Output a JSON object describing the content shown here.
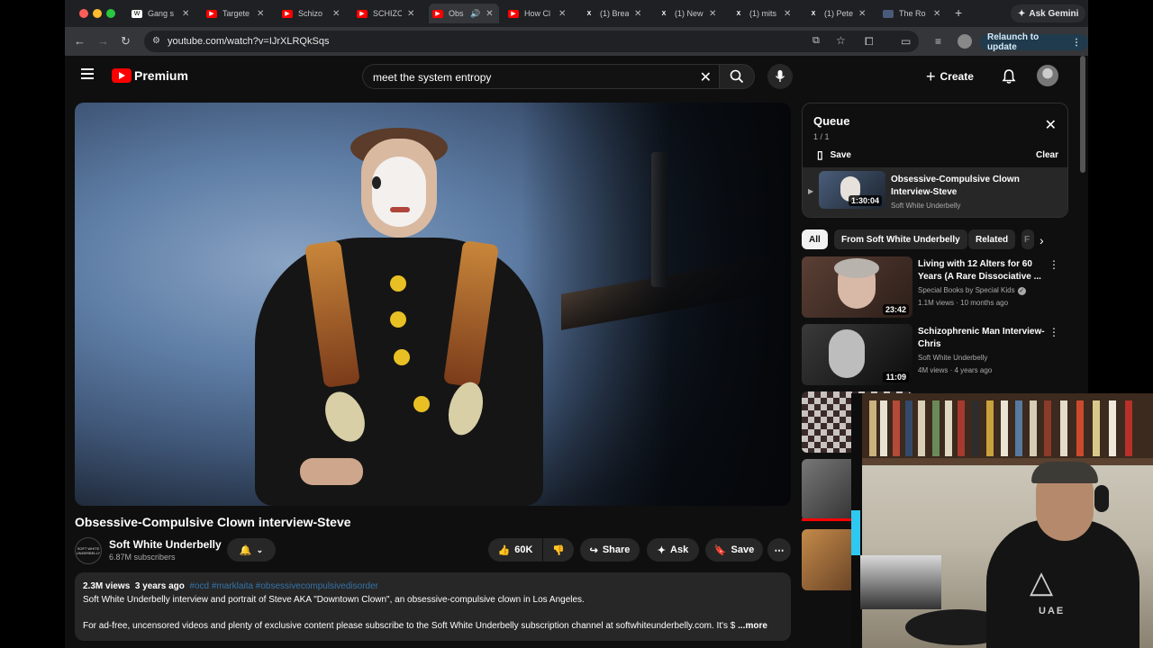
{
  "browser": {
    "tabs": [
      {
        "label": "Gang s",
        "fav": "W",
        "favcolor": "#ffffff"
      },
      {
        "label": "Targete",
        "fav": "",
        "favcolor": "#ff0000"
      },
      {
        "label": "Schizo",
        "fav": "",
        "favcolor": "#ff0000"
      },
      {
        "label": "SCHIZO",
        "fav": "",
        "favcolor": "#ff0000"
      },
      {
        "label": "Obs",
        "fav": "",
        "favcolor": "#ff0000"
      },
      {
        "label": "How Cl",
        "fav": "",
        "favcolor": "#ff0000"
      },
      {
        "label": "(1) Brea",
        "fav": "X",
        "favcolor": "#000000"
      },
      {
        "label": "(1) New",
        "fav": "X",
        "favcolor": "#000000"
      },
      {
        "label": "(1) mits",
        "fav": "X",
        "favcolor": "#000000"
      },
      {
        "label": "(1) Pete",
        "fav": "X",
        "favcolor": "#000000"
      },
      {
        "label": "The Ro",
        "fav": "",
        "favcolor": "#4a5a7a"
      }
    ],
    "ask_gemini": "Ask Gemini",
    "url": "youtube.com/watch?v=IJrXLRQkSqs",
    "relaunch": "Relaunch to update"
  },
  "header": {
    "brand": "Premium",
    "search_query": "meet the system entropy",
    "create_label": "Create"
  },
  "video": {
    "title": "Obsessive-Compulsive Clown interview-Steve",
    "channel": "Soft White Underbelly",
    "channel_avatar_text": "SOFT WHITE UNDERBELLY",
    "subscribers": "6.87M subscribers",
    "likes": "60K",
    "share_label": "Share",
    "ask_label": "Ask",
    "save_label": "Save",
    "views": "2.3M views",
    "age": "3 years ago",
    "tags": "#ocd #marklaita #obsessivecompulsivedisorder",
    "desc_line1": "Soft White Underbelly interview and portrait of Steve AKA \"Downtown Clown\", an obsessive-compulsive clown in Los Angeles.",
    "desc_line2": "For ad-free, uncensored videos and plenty of exclusive content please subscribe to the Soft White Underbelly subscription channel at softwhiteunderbelly.com. It's $",
    "more_label": "...more"
  },
  "queue": {
    "title": "Queue",
    "count": "1 / 1",
    "save_label": "Save",
    "clear_label": "Clear",
    "item": {
      "title": "Obsessive-Compulsive Clown Interview-Steve",
      "channel": "Soft White Underbelly",
      "duration": "1:30:04"
    }
  },
  "chips": [
    "All",
    "From Soft White Underbelly",
    "Related",
    "F"
  ],
  "related": [
    {
      "title": "Living with 12 Alters for 60 Years (A Rare Dissociative ...",
      "channel": "Special Books by Special Kids",
      "meta": "1.1M views · 10 months ago",
      "duration": "23:42",
      "verified": true
    },
    {
      "title": "Schizophrenic Man Interview-Chris",
      "channel": "Soft White Underbelly",
      "meta": "4M views · 4 years ago",
      "duration": "11:09",
      "verified": false
    }
  ],
  "webcam": {
    "shirt_logo": "UAE"
  }
}
